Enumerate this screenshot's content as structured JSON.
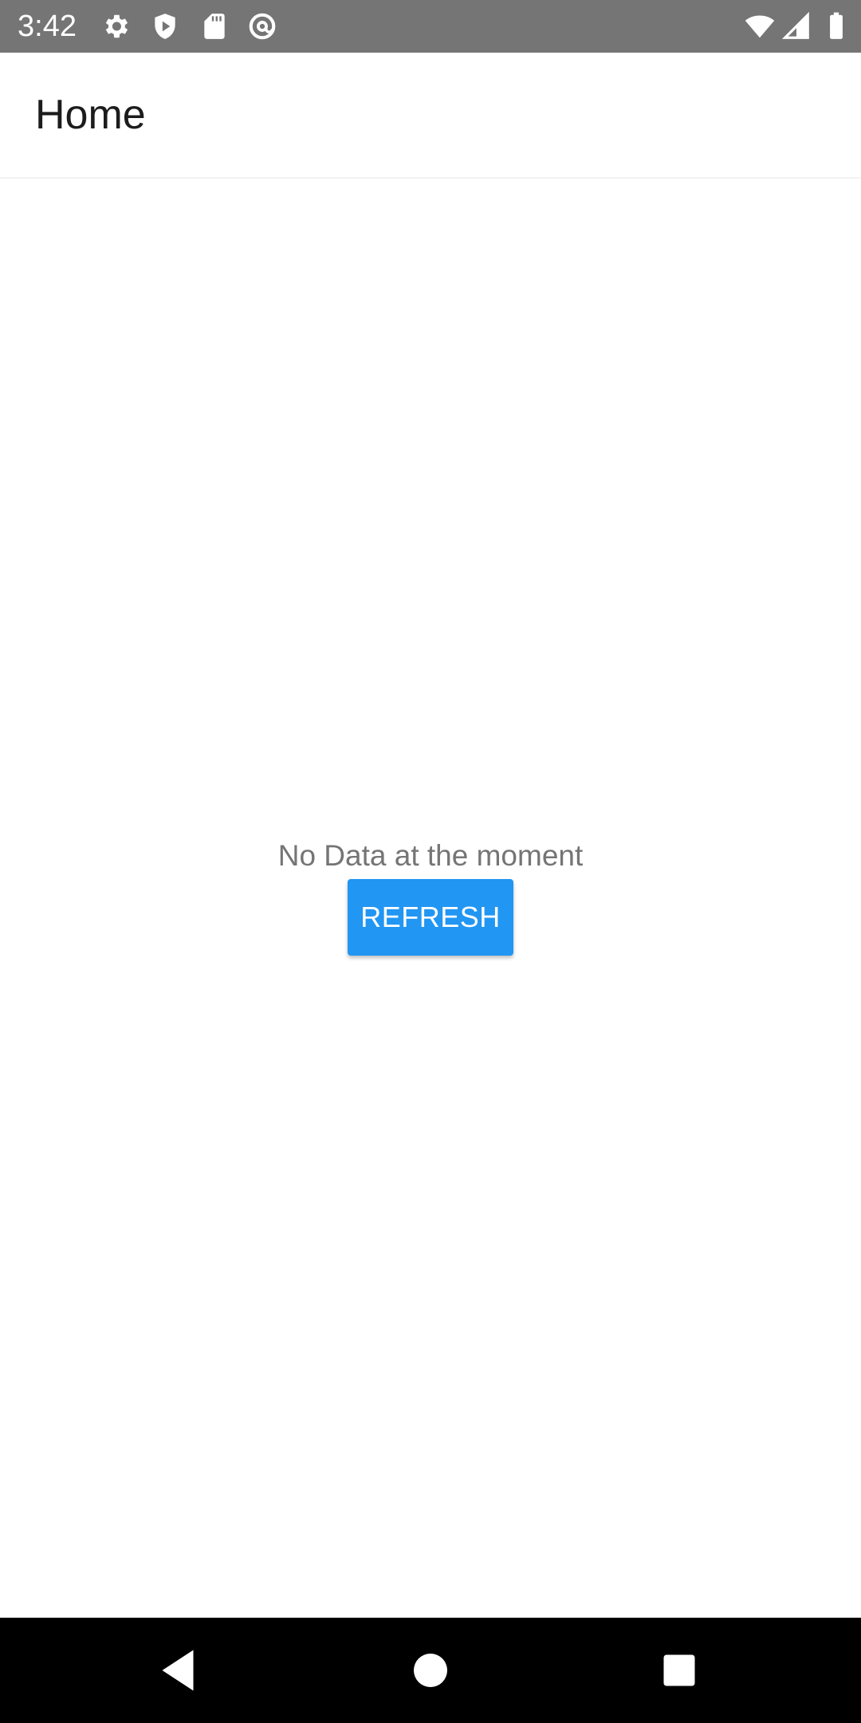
{
  "status_bar": {
    "time": "3:42",
    "background": "#757575",
    "left_icons": [
      "settings-icon",
      "shield-icon",
      "sd-card-icon",
      "at-sign-icon"
    ],
    "right_icons": [
      "wifi-icon",
      "signal-icon",
      "battery-icon"
    ]
  },
  "app_bar": {
    "title": "Home"
  },
  "main": {
    "empty_message": "No Data at the moment",
    "refresh_label": "REFRESH",
    "accent_color": "#2196f3"
  },
  "nav_bar": {
    "buttons": [
      "back-icon",
      "home-icon",
      "recents-icon"
    ]
  }
}
